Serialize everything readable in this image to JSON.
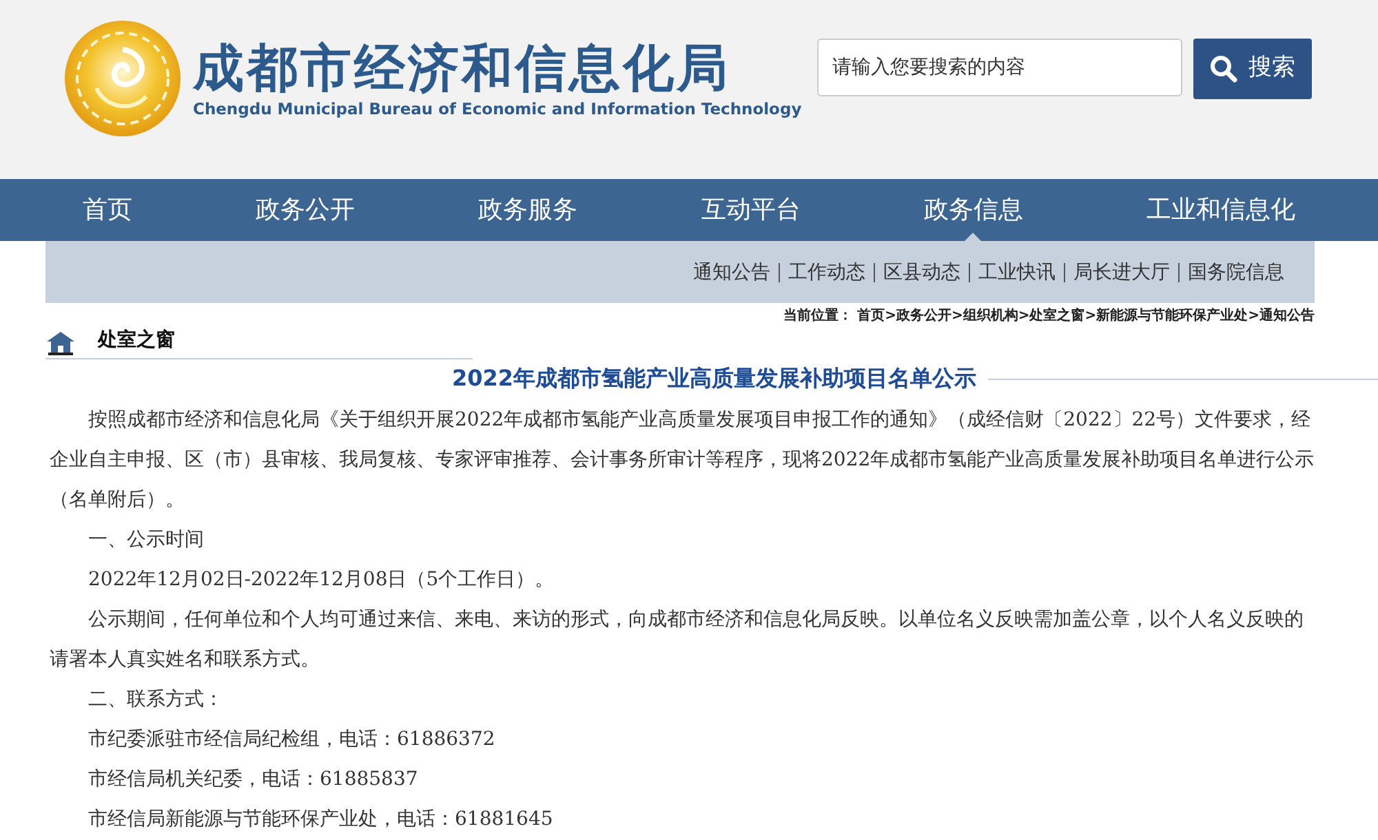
{
  "header": {
    "title": "成都市经济和信息化局",
    "subtitle": "Chengdu Municipal Bureau of Economic and Information Technology",
    "search": {
      "placeholder": "请输入您要搜索的内容",
      "button": "搜索"
    }
  },
  "nav": [
    {
      "label": "首页",
      "selected": false
    },
    {
      "label": "政务公开",
      "selected": false
    },
    {
      "label": "政务服务",
      "selected": false
    },
    {
      "label": "互动平台",
      "selected": false
    },
    {
      "label": "政务信息",
      "selected": true
    },
    {
      "label": "工业和信息化",
      "selected": false
    }
  ],
  "subnav": [
    "通知公告",
    "工作动态",
    "区县动态",
    "工业快讯",
    "局长进大厅",
    "国务院信息"
  ],
  "section": {
    "title": "处室之窗"
  },
  "breadcrumb": {
    "label": "当前位置：",
    "path": "首页>政务公开>组织机构>处室之窗>新能源与节能环保产业处>通知公告"
  },
  "article": {
    "title": "2022年成都市氢能产业高质量发展补助项目名单公示",
    "paragraphs": [
      "按照成都市经济和信息化局《关于组织开展2022年成都市氢能产业高质量发展项目申报工作的通知》（成经信财〔2022〕22号）文件要求，经企业自主申报、区（市）县审核、我局复核、专家评审推荐、会计事务所审计等程序，现将2022年成都市氢能产业高质量发展补助项目名单进行公示（名单附后）。",
      "一、公示时间",
      "2022年12月02日-2022年12月08日（5个工作日）。",
      "公示期间，任何单位和个人均可通过来信、来电、来访的形式，向成都市经济和信息化局反映。以单位名义反映需加盖公章，以个人名义反映的请署本人真实姓名和联系方式。",
      "二、联系方式：",
      "市纪委派驻市经信局纪检组，电话：61886372",
      "市经信局机关纪委，电话：61885837",
      "市经信局新能源与节能环保产业处，电话：61881645"
    ]
  }
}
